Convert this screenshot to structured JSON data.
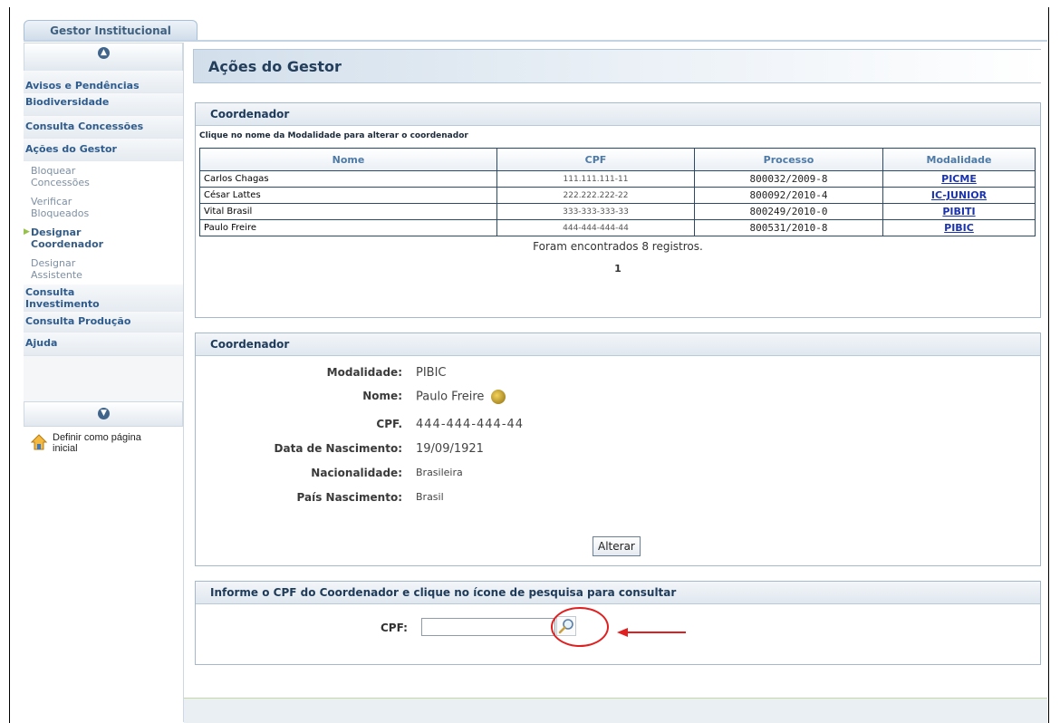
{
  "app": {
    "tab_label": "Gestor Institucional"
  },
  "sidebar": {
    "items": [
      {
        "label": "Avisos e Pendências"
      },
      {
        "label": "Biodiversidade"
      },
      {
        "label": "Consulta Concessões"
      },
      {
        "label": "Ações do Gestor"
      },
      {
        "label": "Consulta Investimento"
      },
      {
        "label": "Consulta Produção"
      },
      {
        "label": "Ajuda"
      }
    ],
    "subitems": [
      {
        "label": "Bloquear Concessões"
      },
      {
        "label": "Verificar Bloqueados"
      },
      {
        "label": "Designar Coordenador",
        "active": true
      },
      {
        "label": "Designar Assistente"
      }
    ],
    "homepage_label": "Definir como página inicial"
  },
  "page_title": "Ações do Gestor",
  "list_panel": {
    "title": "Coordenador",
    "hint": "Clique no nome da Modalidade para alterar o coordenador",
    "columns": [
      "Nome",
      "CPF",
      "Processo",
      "Modalidade"
    ],
    "rows": [
      {
        "nome": "Carlos Chagas",
        "cpf": "111.111.111-11",
        "processo": "800032/2009-8",
        "modalidade": "PICME"
      },
      {
        "nome": "César Lattes",
        "cpf": "222.222.222-22",
        "processo": "800092/2010-4",
        "modalidade": "IC-JUNIOR"
      },
      {
        "nome": "Vital Brasil",
        "cpf": "333-333-333-33",
        "processo": "800249/2010-0",
        "modalidade": "PIBITI"
      },
      {
        "nome": "Paulo Freire",
        "cpf": "444-444-444-44",
        "processo": "800531/2010-8",
        "modalidade": "PIBIC"
      }
    ],
    "found_text": "Foram encontrados 8 registros.",
    "page_number": "1"
  },
  "detail_panel": {
    "title": "Coordenador",
    "fields": [
      {
        "label": "Modalidade:",
        "value": "PIBIC"
      },
      {
        "label": "Nome:",
        "value": "Paulo Freire"
      },
      {
        "label": "CPF.",
        "value": "444-444-444-44"
      },
      {
        "label": "Data de Nascimento:",
        "value": "19/09/1921"
      },
      {
        "label": "Nacionalidade:",
        "value": "Brasileira"
      },
      {
        "label": "País Nascimento:",
        "value": "Brasil"
      }
    ],
    "alterar_label": "Alterar"
  },
  "search_panel": {
    "title": "Informe o CPF do Coordenador e clique no ícone de pesquisa para consultar",
    "cpf_label": "CPF:",
    "cpf_value": "",
    "search_icon": "magnifier-icon"
  },
  "colors": {
    "link": "#1a33b0",
    "header_text": "#4e7aa5",
    "annotation": "#e02020",
    "active_marker": "#97c14b"
  }
}
